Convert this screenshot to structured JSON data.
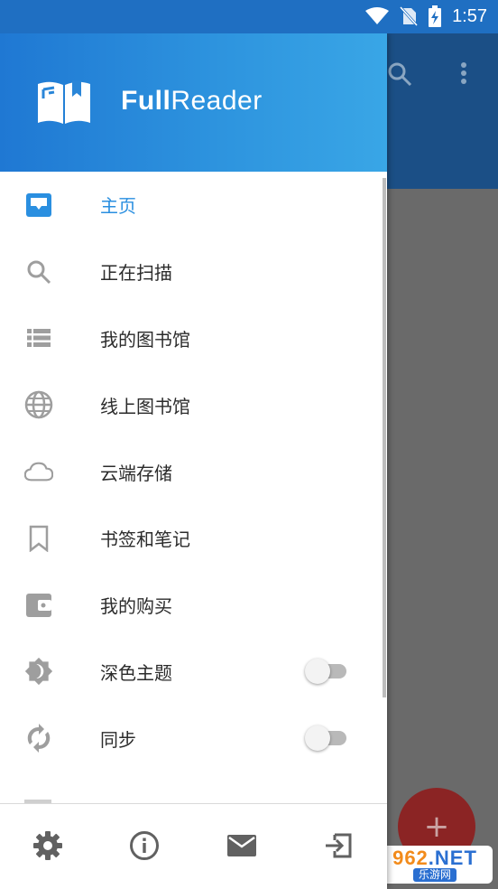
{
  "status_bar": {
    "time": "1:57"
  },
  "drawer": {
    "brand": {
      "bold": "Full",
      "regular": "Reader"
    },
    "menu": [
      {
        "label": "主页",
        "icon": "home-tray-icon",
        "active": true
      },
      {
        "label": "正在扫描",
        "icon": "search-icon"
      },
      {
        "label": "我的图书馆",
        "icon": "list-icon"
      },
      {
        "label": "线上图书馆",
        "icon": "globe-icon"
      },
      {
        "label": "云端存储",
        "icon": "cloud-icon"
      },
      {
        "label": "书签和笔记",
        "icon": "bookmark-icon"
      },
      {
        "label": "我的购买",
        "icon": "wallet-icon"
      },
      {
        "label": "深色主题",
        "icon": "brightness-icon",
        "toggle": false
      },
      {
        "label": "同步",
        "icon": "sync-icon",
        "toggle": false
      }
    ],
    "bottom_bar": [
      "gear-icon",
      "info-icon",
      "mail-icon",
      "exit-icon"
    ]
  },
  "fab": {
    "label": "+"
  },
  "watermark": {
    "top_a": "962",
    "top_b": ".NET",
    "bottom": "乐游网"
  },
  "colors": {
    "accent": "#2a8fe0",
    "header_start": "#1f78d3",
    "header_end": "#39a6e6",
    "icon_gray": "#9e9e9e"
  }
}
